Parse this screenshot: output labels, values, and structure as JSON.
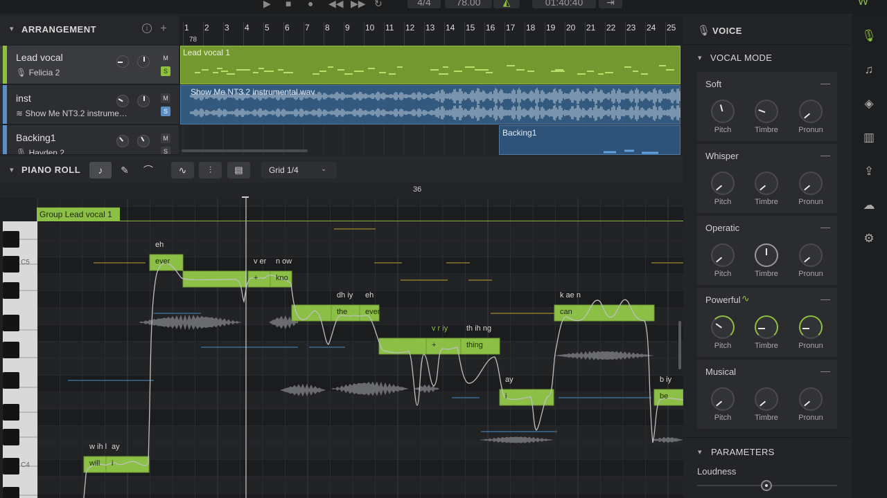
{
  "transport": {
    "time_signature": "4/4",
    "tempo": "78.00",
    "time_display": "01:40:40"
  },
  "arrangement": {
    "title": "ARRANGEMENT",
    "bar_numbers": [
      "1",
      "2",
      "3",
      "4",
      "5",
      "6",
      "7",
      "8",
      "9",
      "10",
      "11",
      "12",
      "13",
      "14",
      "15",
      "16",
      "17",
      "18",
      "19",
      "20",
      "21",
      "22",
      "23",
      "24",
      "25"
    ],
    "tempo_marker": "78",
    "tracks": [
      {
        "name": "Lead vocal",
        "sub": "Felicia 2",
        "color": "#8fbf3f",
        "m": "M",
        "s": "S",
        "clip": "Lead vocal 1"
      },
      {
        "name": "inst",
        "sub": "Show Me NT3.2 instrume…",
        "color": "#5b8ec4",
        "m": "M",
        "s": "S",
        "clip": "Show Me NT3.2 instrumental.wav"
      },
      {
        "name": "Backing1",
        "sub": "Hayden 2",
        "color": "#5b8ec4",
        "m": "M",
        "s": "S",
        "clip": "Backing1"
      }
    ]
  },
  "piano_roll": {
    "title": "PIANO ROLL",
    "grid_label": "Grid 1/4",
    "bar_marker": "36",
    "group_label": "Group Lead vocal 1",
    "key_labels": {
      "c5": "C5",
      "c4": "C4"
    },
    "notes": [
      {
        "lyric": "will",
        "phoneme": "w ih l"
      },
      {
        "lyric": "i",
        "phoneme": "ay"
      },
      {
        "lyric": "ever",
        "phoneme": "eh"
      },
      {
        "lyric": "",
        "phoneme": ""
      },
      {
        "lyric": "+",
        "phoneme": "v er"
      },
      {
        "lyric": "kno",
        "phoneme": "n ow"
      },
      {
        "lyric": "",
        "phoneme": ""
      },
      {
        "lyric": "the",
        "phoneme": "dh iy"
      },
      {
        "lyric": "ever",
        "phoneme": "eh"
      },
      {
        "lyric": "",
        "phoneme": ""
      },
      {
        "lyric": "+",
        "phoneme": "v r iy"
      },
      {
        "lyric": "thing",
        "phoneme": "th ih ng"
      },
      {
        "lyric": "i",
        "phoneme": "ay"
      },
      {
        "lyric": "can",
        "phoneme": "k ae n"
      },
      {
        "lyric": "be",
        "phoneme": "b iy"
      }
    ]
  },
  "voice": {
    "title": "VOICE",
    "vocal_mode_title": "VOCAL MODE",
    "knob_labels": {
      "pitch": "Pitch",
      "timbre": "Timbre",
      "pronun": "Pronun"
    },
    "modes": [
      {
        "name": "Soft",
        "dash": "—"
      },
      {
        "name": "Whisper",
        "dash": "—"
      },
      {
        "name": "Operatic",
        "dash": "—"
      },
      {
        "name": "Powerful",
        "dash": "—"
      },
      {
        "name": "Musical",
        "dash": "—"
      }
    ],
    "parameters_title": "PARAMETERS",
    "loudness_label": "Loudness"
  },
  "colors": {
    "accent": "#8fbf3f",
    "note": "#8bbf45",
    "audio": "#3b6d9e"
  }
}
